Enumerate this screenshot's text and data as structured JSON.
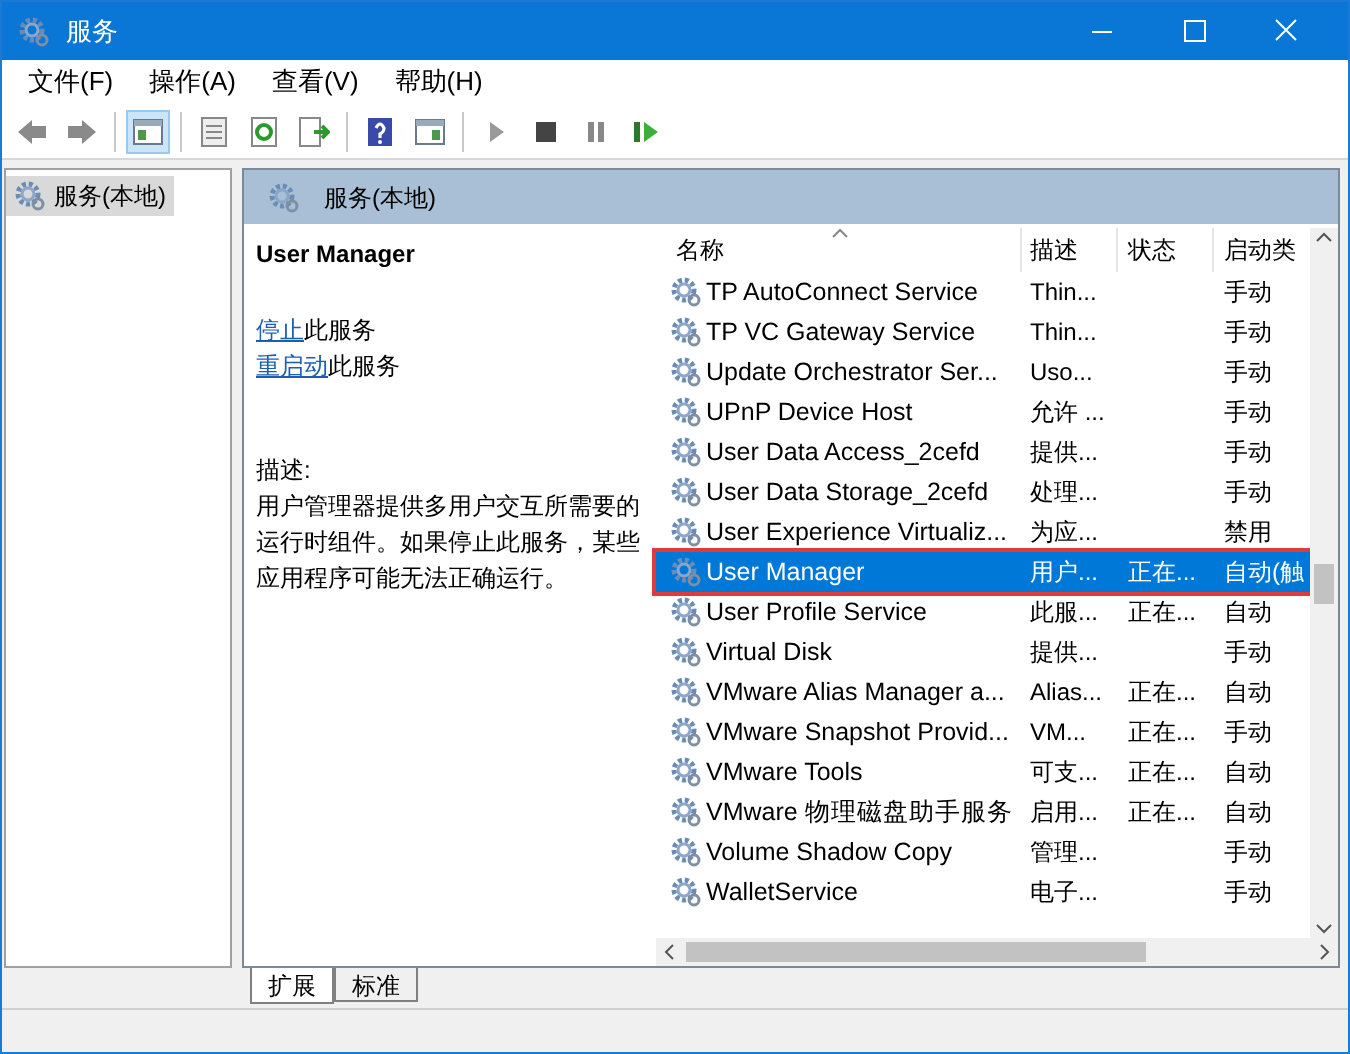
{
  "window": {
    "title": "服务"
  },
  "menu": [
    "文件(F)",
    "操作(A)",
    "查看(V)",
    "帮助(H)"
  ],
  "toolbar": [
    [
      {
        "kind": "back",
        "pressed": false
      },
      {
        "kind": "forward",
        "pressed": false
      }
    ],
    [
      {
        "kind": "tree",
        "pressed": true
      }
    ],
    [
      {
        "kind": "properties",
        "pressed": false
      },
      {
        "kind": "refresh",
        "pressed": false
      },
      {
        "kind": "export",
        "pressed": false
      }
    ],
    [
      {
        "kind": "help",
        "pressed": false
      },
      {
        "kind": "pane",
        "pressed": false
      }
    ],
    [
      {
        "kind": "play",
        "pressed": false
      },
      {
        "kind": "stop",
        "pressed": false
      },
      {
        "kind": "pause",
        "pressed": false
      },
      {
        "kind": "resume",
        "pressed": false
      }
    ]
  ],
  "tree": [
    {
      "label": "服务(本地)",
      "selected": true
    }
  ],
  "panel_header": "服务(本地)",
  "details": {
    "title": "User Manager",
    "actions": [
      {
        "link": "停止",
        "rest": "此服务"
      },
      {
        "link": "重启动",
        "rest": "此服务"
      }
    ],
    "description_label": "描述:",
    "description": "用户管理器提供多用户交互所需要的运行时组件。如果停止此服务，某些应用程序可能无法正确运行。"
  },
  "table": {
    "columns": [
      "名称",
      "描述",
      "状态",
      "启动类"
    ],
    "rows": [
      {
        "name": "TP AutoConnect Service",
        "description": "Thin...",
        "status": "",
        "startup": "手动",
        "selected": false
      },
      {
        "name": "TP VC Gateway Service",
        "description": "Thin...",
        "status": "",
        "startup": "手动",
        "selected": false
      },
      {
        "name": "Update Orchestrator Ser...",
        "description": "Uso...",
        "status": "",
        "startup": "手动",
        "selected": false
      },
      {
        "name": "UPnP Device Host",
        "description": "允许 ...",
        "status": "",
        "startup": "手动",
        "selected": false
      },
      {
        "name": "User Data Access_2cefd",
        "description": "提供...",
        "status": "",
        "startup": "手动",
        "selected": false
      },
      {
        "name": "User Data Storage_2cefd",
        "description": "处理...",
        "status": "",
        "startup": "手动",
        "selected": false
      },
      {
        "name": "User Experience Virtualiz...",
        "description": "为应...",
        "status": "",
        "startup": "禁用",
        "selected": false
      },
      {
        "name": "User Manager",
        "description": "用户...",
        "status": "正在...",
        "startup": "自动(触",
        "selected": true
      },
      {
        "name": "User Profile Service",
        "description": "此服...",
        "status": "正在...",
        "startup": "自动",
        "selected": false
      },
      {
        "name": "Virtual Disk",
        "description": "提供...",
        "status": "",
        "startup": "手动",
        "selected": false
      },
      {
        "name": "VMware Alias Manager a...",
        "description": "Alias...",
        "status": "正在...",
        "startup": "自动",
        "selected": false
      },
      {
        "name": "VMware Snapshot Provid...",
        "description": "VM...",
        "status": "正在...",
        "startup": "手动",
        "selected": false
      },
      {
        "name": "VMware Tools",
        "description": "可支...",
        "status": "正在...",
        "startup": "自动",
        "selected": false
      },
      {
        "name": "VMware 物理磁盘助手服务",
        "description": "启用...",
        "status": "正在...",
        "startup": "自动",
        "selected": false
      },
      {
        "name": "Volume Shadow Copy",
        "description": "管理...",
        "status": "",
        "startup": "手动",
        "selected": false
      },
      {
        "name": "WalletService",
        "description": "电子...",
        "status": "",
        "startup": "手动",
        "selected": false
      }
    ]
  },
  "tabs": [
    {
      "label": "扩展",
      "selected": true
    },
    {
      "label": "标准",
      "selected": false
    }
  ]
}
